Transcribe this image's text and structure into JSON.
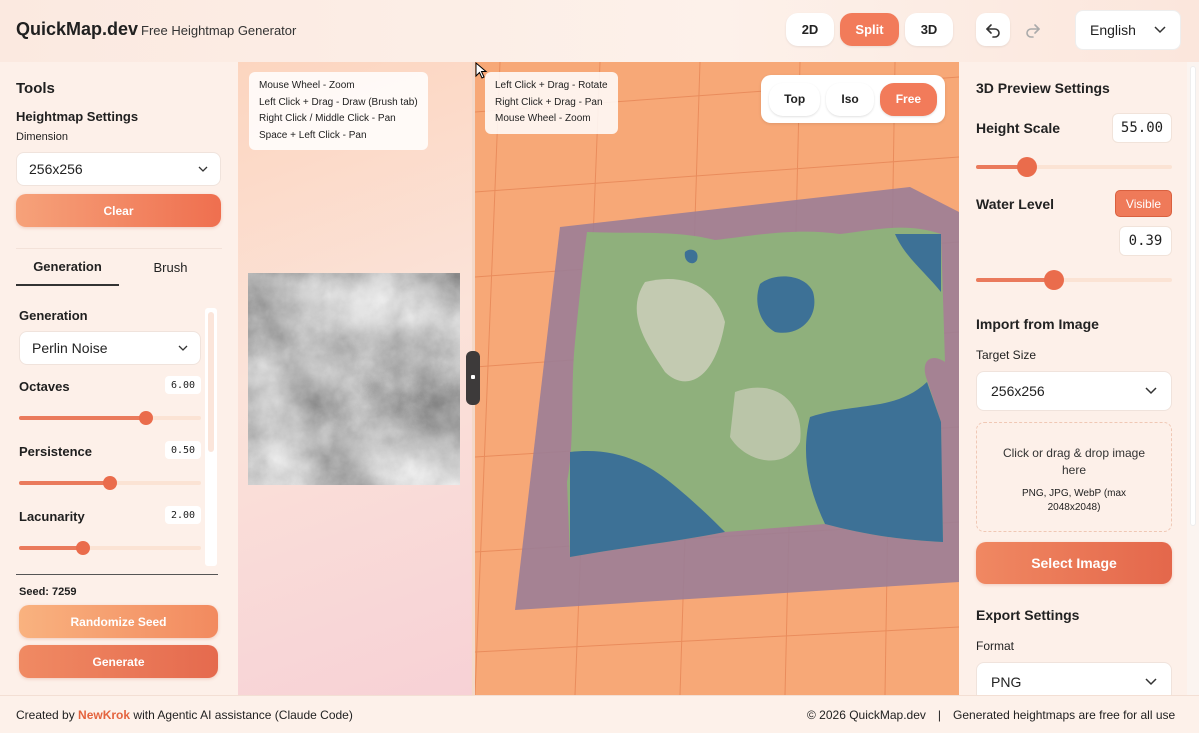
{
  "header": {
    "brand": "QuickMap.dev",
    "subtitle": "Free Heightmap Generator",
    "modes": [
      "2D",
      "Split",
      "3D"
    ],
    "active_mode": "Split",
    "language": "English"
  },
  "left": {
    "tools_title": "Tools",
    "heightmap_settings": "Heightmap Settings",
    "dimension_label": "Dimension",
    "dimension_value": "256x256",
    "clear_label": "Clear",
    "tabs": [
      "Generation",
      "Brush"
    ],
    "active_tab": "Generation",
    "generation_label": "Generation",
    "generation_value": "Perlin Noise",
    "params": [
      {
        "label": "Octaves",
        "value": "6.00",
        "fraction": 0.7
      },
      {
        "label": "Persistence",
        "value": "0.50",
        "fraction": 0.5
      },
      {
        "label": "Lacunarity",
        "value": "2.00",
        "fraction": 0.35
      }
    ],
    "seed": "Seed: 7259",
    "randomize_label": "Randomize Seed",
    "generate_label": "Generate"
  },
  "view2d": {
    "hints": [
      "Mouse Wheel - Zoom",
      "Left Click + Drag - Draw (Brush tab)",
      "Right Click / Middle Click - Pan",
      "Space + Left Click - Pan"
    ]
  },
  "view3d": {
    "hints": [
      "Left Click + Drag - Rotate",
      "Right Click + Drag - Pan",
      "Mouse Wheel - Zoom"
    ],
    "camera": [
      "Top",
      "Iso",
      "Free"
    ],
    "active_camera": "Free"
  },
  "right": {
    "title": "3D Preview Settings",
    "height_scale_label": "Height Scale",
    "height_scale_value": "55.00",
    "height_scale_fraction": 0.26,
    "water_label": "Water Level",
    "water_visible": "Visible",
    "water_value": "0.39",
    "water_fraction": 0.4,
    "import_title": "Import from Image",
    "target_size_label": "Target Size",
    "target_size_value": "256x256",
    "drop_main": "Click or drag & drop image here",
    "drop_sub": "PNG, JPG, WebP (max 2048x2048)",
    "select_image": "Select Image",
    "export_title": "Export Settings",
    "format_label": "Format",
    "format_value": "PNG"
  },
  "footer": {
    "created_by": "Created by ",
    "author": "NewKrok",
    "created_suffix": " with Agentic AI assistance (Claude Code)",
    "copyright": "© 2026 QuickMap.dev",
    "separator": "|",
    "free_note": "Generated heightmaps are free for all use"
  },
  "colors": {
    "accent": "#f27b5a",
    "terrain_green": "#8fb07c",
    "water": "#3d7196"
  }
}
